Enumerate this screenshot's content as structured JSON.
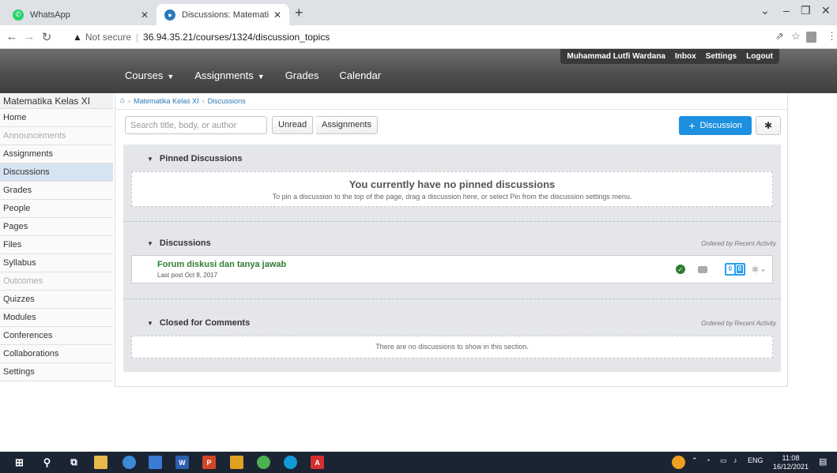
{
  "browser": {
    "tabs": [
      {
        "title": "WhatsApp",
        "icon": "whatsapp-icon"
      },
      {
        "title": "Discussions: Matematika Wajib X",
        "icon": "canvas-icon"
      }
    ],
    "url_prefix": "Not secure",
    "url": "36.94.35.21/courses/1324/discussion_topics"
  },
  "header": {
    "user_name": "Muhammad Lutfi Wardana",
    "inbox": "Inbox",
    "settings": "Settings",
    "logout": "Logout",
    "nav": [
      "Courses",
      "Assignments",
      "Grades",
      "Calendar"
    ]
  },
  "sidebar": {
    "course_name": "Matematika Kelas XI",
    "items": [
      {
        "label": "Home"
      },
      {
        "label": "Announcements"
      },
      {
        "label": "Assignments"
      },
      {
        "label": "Discussions"
      },
      {
        "label": "Grades"
      },
      {
        "label": "People"
      },
      {
        "label": "Pages"
      },
      {
        "label": "Files"
      },
      {
        "label": "Syllabus"
      },
      {
        "label": "Outcomes"
      },
      {
        "label": "Quizzes"
      },
      {
        "label": "Modules"
      },
      {
        "label": "Conferences"
      },
      {
        "label": "Collaborations"
      },
      {
        "label": "Settings"
      }
    ]
  },
  "breadcrumb": [
    "Matematika Kelas XI",
    "Discussions"
  ],
  "toolbar": {
    "search_placeholder": "Search title, body, or author",
    "unread": "Unread",
    "assignments": "Assignments",
    "add_discussion": "Discussion"
  },
  "pinned": {
    "title": "Pinned Discussions",
    "empty_title": "You currently have no pinned discussions",
    "empty_sub": "To pin a discussion to the top of the page, drag a discussion here, or select Pin from the discussion settings menu."
  },
  "discussions": {
    "title": "Discussions",
    "ordered": "Ordered by Recent Activity",
    "items": [
      {
        "title": "Forum diskusi dan tanya jawab",
        "meta": "Last post Oct 8, 2017",
        "count_a": "0",
        "count_b": "0"
      }
    ]
  },
  "closed": {
    "title": "Closed for Comments",
    "ordered": "Ordered by Recent Activity",
    "empty": "There are no discussions to show in this section."
  },
  "taskbar": {
    "lang": "ENG",
    "time": "11:08",
    "date": "16/12/2021"
  },
  "colors": {
    "accent": "#1e90e0",
    "active_nav": "#d6e4f2",
    "discussion_title": "#2e7d32"
  }
}
